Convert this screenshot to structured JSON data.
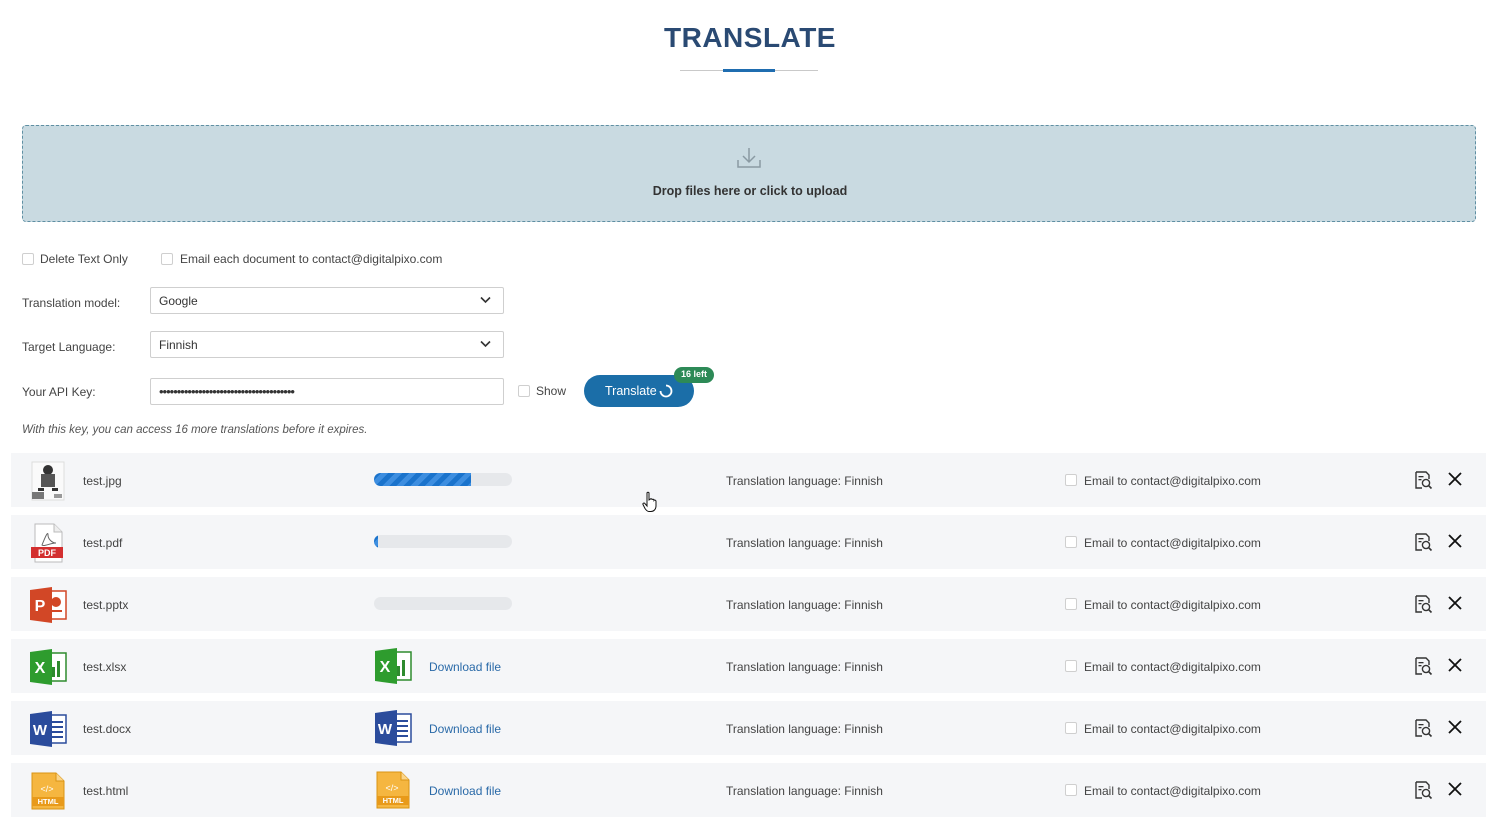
{
  "header": {
    "title": "TRANSLATE"
  },
  "dropzone": {
    "text": "Drop files here or click to upload",
    "icon": "download-tray-icon"
  },
  "options": {
    "delete_text_only": "Delete Text Only",
    "email_each": "Email each document to contact@digitalpixo.com"
  },
  "form": {
    "model_label": "Translation model:",
    "model_value": "Google",
    "language_label": "Target Language:",
    "language_value": "Finnish",
    "api_label": "Your API Key:",
    "api_value": "••••••••••••••••••••••••••••••••••••••",
    "show_label": "Show",
    "translate_label": "Translate",
    "badge": "16 left",
    "note": "With this key, you can access 16 more translations before it expires."
  },
  "colors": {
    "accent": "#1b6ea8",
    "badge": "#2d8a57",
    "dropzone": "#c9dae1",
    "title": "#2a4a73"
  },
  "files": [
    {
      "name": "test.jpg",
      "icon": "jpg-thumbnail-icon",
      "status": "progress",
      "progress": 0.7,
      "language": "Translation language: Finnish",
      "email": "Email to contact@digitalpixo.com"
    },
    {
      "name": "test.pdf",
      "icon": "pdf-file-icon",
      "status": "progress",
      "progress": 0.03,
      "language": "Translation language: Finnish",
      "email": "Email to contact@digitalpixo.com"
    },
    {
      "name": "test.pptx",
      "icon": "powerpoint-file-icon",
      "status": "progress",
      "progress": 0,
      "language": "Translation language: Finnish",
      "email": "Email to contact@digitalpixo.com"
    },
    {
      "name": "test.xlsx",
      "icon": "excel-file-icon",
      "status": "done",
      "download": "Download file",
      "language": "Translation language: Finnish",
      "email": "Email to contact@digitalpixo.com"
    },
    {
      "name": "test.docx",
      "icon": "word-file-icon",
      "status": "done",
      "download": "Download file",
      "language": "Translation language: Finnish",
      "email": "Email to contact@digitalpixo.com"
    },
    {
      "name": "test.html",
      "icon": "html-file-icon",
      "status": "done",
      "download": "Download file",
      "language": "Translation language: Finnish",
      "email": "Email to contact@digitalpixo.com"
    }
  ]
}
